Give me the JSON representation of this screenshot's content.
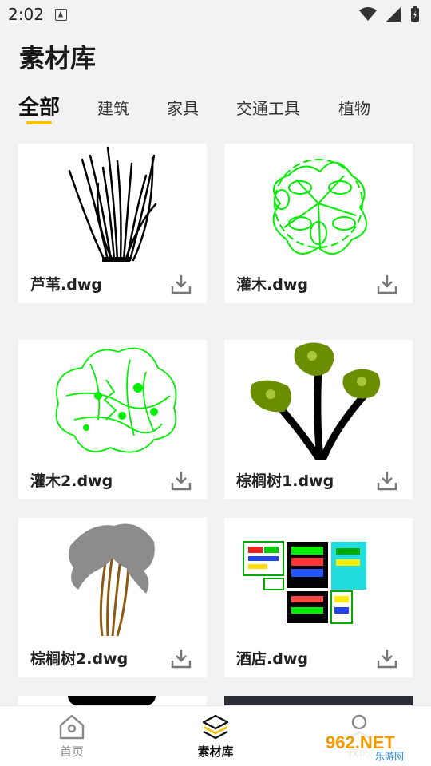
{
  "status_bar": {
    "time": "2:02"
  },
  "page": {
    "title": "素材库"
  },
  "tabs": [
    {
      "label": "全部",
      "active": true
    },
    {
      "label": "建筑",
      "active": false
    },
    {
      "label": "家具",
      "active": false
    },
    {
      "label": "交通工具",
      "active": false
    },
    {
      "label": "植物",
      "active": false
    }
  ],
  "colors": {
    "accent": "#f6c000",
    "cad_green": "#00ee00",
    "palm_green": "#6b8e00"
  },
  "cards": [
    {
      "name": "芦苇.dwg",
      "thumb": "reed-drawing"
    },
    {
      "name": "灌木.dwg",
      "thumb": "shrub-drawing"
    },
    {
      "name": "灌木2.dwg",
      "thumb": "shrub2-drawing"
    },
    {
      "name": "棕榈树1.dwg",
      "thumb": "palm1-drawing"
    },
    {
      "name": "棕榈树2.dwg",
      "thumb": "palm2-drawing"
    },
    {
      "name": "酒店.dwg",
      "thumb": "hotel-plan-drawing"
    }
  ],
  "bottom_nav": [
    {
      "label": "首页",
      "icon": "home-icon",
      "active": false
    },
    {
      "label": "素材库",
      "icon": "layers-icon",
      "active": true
    },
    {
      "label": "我的",
      "icon": "person-icon",
      "active": false
    }
  ],
  "watermark": {
    "text": "962.NET",
    "sub": "乐游网"
  }
}
